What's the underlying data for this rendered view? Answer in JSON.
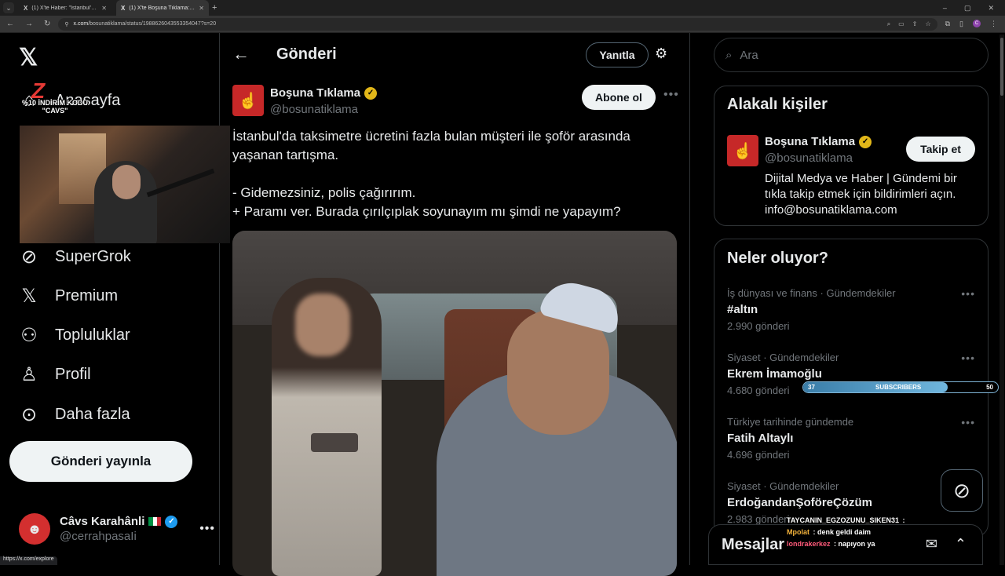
{
  "browser": {
    "tabs": [
      {
        "title": "(1) X'te Haber: \"İstanbul'da bir",
        "active": false
      },
      {
        "title": "(1) X'te Boşuna Tıklama: \"İstanbul",
        "active": true
      }
    ],
    "url_host": "x.com",
    "url_path": "/bosunatiklama/status/1988626043553354047?s=20",
    "status_url": "https://x.com/explore",
    "profile_initial": "C"
  },
  "sidebar": {
    "home_label": "Anasayfa",
    "items": [
      {
        "label": "SuperGrok",
        "icon": "grok-icon"
      },
      {
        "label": "Premium",
        "icon": "x-icon"
      },
      {
        "label": "Topluluklar",
        "icon": "communities-icon"
      },
      {
        "label": "Profil",
        "icon": "profile-icon"
      },
      {
        "label": "Daha fazla",
        "icon": "more-circle-icon"
      }
    ],
    "post_button": "Gönderi yayınla",
    "account": {
      "name": "Câvs Karahânli",
      "handle": "@cerrahpasaIi"
    }
  },
  "overlay": {
    "promo_line1": "%10 İNDİRİM KODU",
    "promo_line2": "\"CAVS\"",
    "logo_text": "Z"
  },
  "main": {
    "title": "Gönderi",
    "reply_button": "Yanıtla",
    "post": {
      "author": "Boşuna Tıklama",
      "handle": "@bosunatiklama",
      "follow_button": "Abone ol",
      "lines": [
        "İstanbul'da taksimetre ücretini fazla bulan müşteri ile şoför arasında yaşanan tartışma.",
        "",
        "- Gidemezsiniz, polis çağırırım.",
        "+ Paramı ver. Burada çırılçıplak soyunayım mı şimdi ne yapayım?"
      ]
    }
  },
  "right": {
    "search_placeholder": "Ara",
    "relevant": {
      "title": "Alakalı kişiler",
      "name": "Boşuna Tıklama",
      "handle": "@bosunatiklama",
      "follow_button": "Takip et",
      "bio": "Dijital Medya ve Haber | Gündemi bir tıkla takip etmek için bildirimleri açın. info@bosunatiklama.com"
    },
    "trends": {
      "title": "Neler oluyor?",
      "items": [
        {
          "context": "İş dünyası ve finans · Gündemdekiler",
          "name": "#altın",
          "count": "2.990 gönderi"
        },
        {
          "context": "Siyaset · Gündemdekiler",
          "name": "Ekrem İmamoğlu",
          "count": "4.680 gönderi"
        },
        {
          "context": "Türkiye tarihinde gündemde",
          "name": "Fatih Altaylı",
          "count": "4.696 gönderi"
        },
        {
          "context": "Siyaset · Gündemdekiler",
          "name": "ErdoğandanŞoföreÇözüm",
          "count": "2.983 gönderi"
        }
      ]
    },
    "messages_title": "Mesajlar"
  },
  "subscribers": {
    "current": "37",
    "label": "SUBSCRIBERS",
    "goal": "50",
    "progress": 0.74
  },
  "chat": [
    {
      "user": "TAYCANIN_EGZOZUNU_SIKEN31",
      "text": ":"
    },
    {
      "user": "Mpolat",
      "text": ": denk geldi daim"
    },
    {
      "user": "londrakerkez",
      "text": ": napıyon ya"
    }
  ],
  "colors": {
    "accent": "#1d9bf0",
    "background": "#000000",
    "muted": "#71767b",
    "verified_gold": "#e2b719",
    "brand_red": "#c62828"
  }
}
